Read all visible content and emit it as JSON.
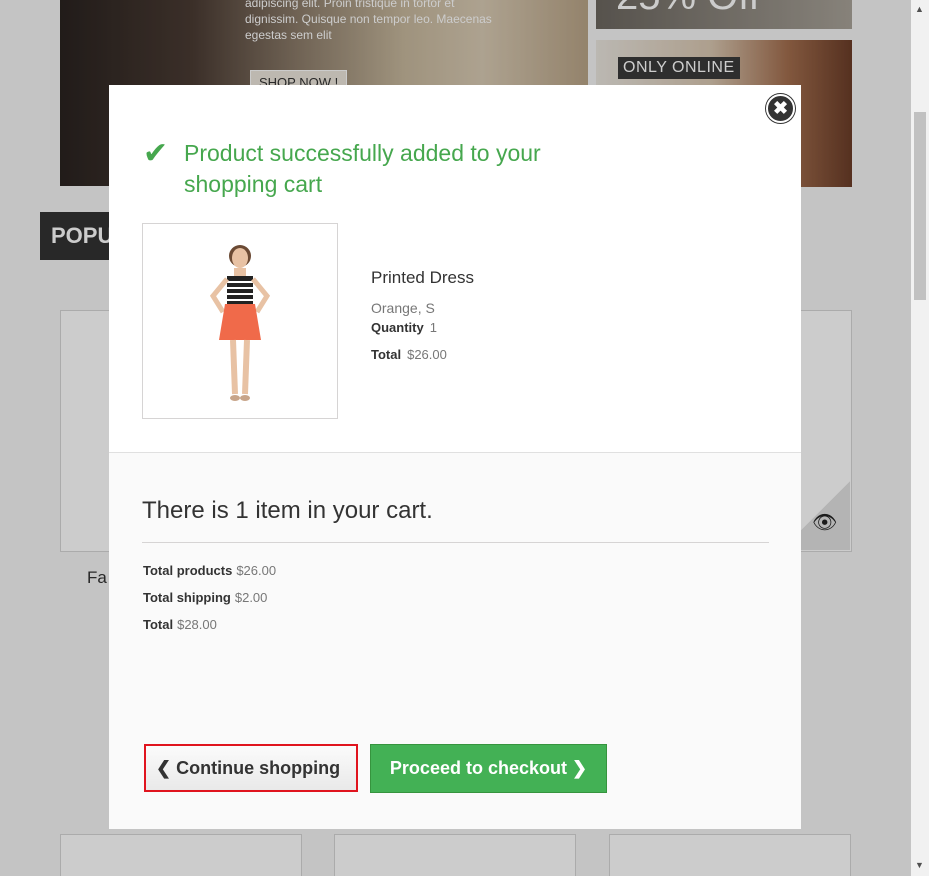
{
  "background": {
    "banner_text": "adipiscing elit. Proin tristique in tortor et dignissim. Quisque non tempor leo. Maecenas egestas sem elit",
    "shop_now": "SHOP NOW !",
    "discount": "25% Off",
    "only_online": "ONLY ONLINE",
    "popular_tab": "POPU",
    "product_fragment": "Fa"
  },
  "modal": {
    "success_message": "Product successfully added to your shopping cart",
    "product": {
      "name": "Printed Dress",
      "attributes": "Orange, S",
      "quantity_label": "Quantity",
      "quantity": "1",
      "total_label": "Total",
      "total": "$26.00"
    },
    "cart": {
      "heading": "There is 1 item in your cart.",
      "total_products_label": "Total products",
      "total_products": "$26.00",
      "total_shipping_label": "Total shipping",
      "total_shipping": "$2.00",
      "total_label": "Total",
      "total": "$28.00"
    },
    "buttons": {
      "continue": "Continue shopping",
      "checkout": "Proceed to checkout"
    },
    "colors": {
      "success": "#46a74e",
      "checkout_button": "#43b155",
      "focus_outline": "#e0141e"
    }
  }
}
